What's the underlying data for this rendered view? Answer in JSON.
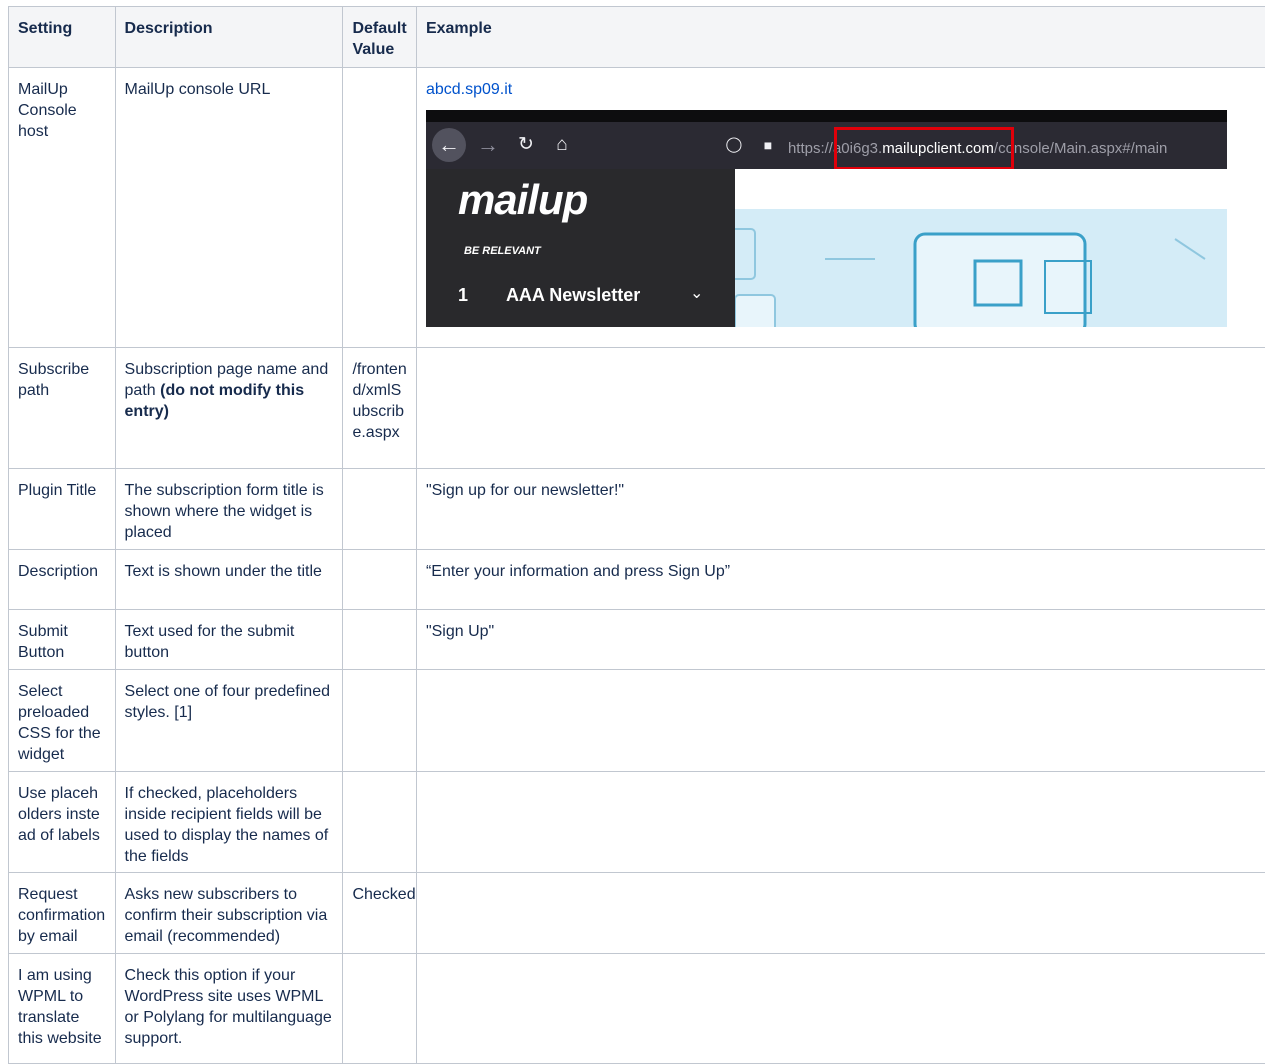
{
  "headers": {
    "setting": "Setting",
    "description": "Description",
    "default": "Default Value",
    "example": "Example"
  },
  "rows": [
    {
      "setting": "MailUp Console host",
      "description": "MailUp console URL",
      "default": "",
      "example": "abcd.sp09.it"
    },
    {
      "setting": "Subscribe path",
      "description": "Subscription page name and path ",
      "description_bold": "(do not modify this entry)",
      "default": "/frontend/xmlSubscribe.aspx",
      "example": ""
    },
    {
      "setting": "Plugin Title",
      "description": "The subscription form title is shown where the widget is placed",
      "default": "",
      "example": "\"Sign up for our newsletter!\""
    },
    {
      "setting": "Description",
      "description": "Text is shown under the title",
      "default": "",
      "example": "“Enter your information and press Sign Up”"
    },
    {
      "setting": "Submit Button",
      "description": "Text used for the submit button",
      "default": "",
      "example": "\"Sign Up\""
    },
    {
      "setting": "Select preloaded CSS for the widget",
      "description": "Select one of four predefined styles. [1]",
      "default": "",
      "example": ""
    },
    {
      "setting": "Use placeholders instead of labels",
      "description": "If checked, placeholders inside recipient fields will be used to display the names of the fields",
      "default": "",
      "example": ""
    },
    {
      "setting": "Request confirmation by email",
      "description": "Asks new subscribers to confirm their subscription via email (recommended)",
      "default": "Checked",
      "example": ""
    },
    {
      "setting": "I am using WPML to translate this website",
      "description": "Check this option if your WordPress site uses WPML or Polylang for multilanguage support.",
      "default": "",
      "example": ""
    }
  ],
  "screenshot": {
    "url_prefix": "https://",
    "url_host_pre": "a0i6g3.",
    "url_host": "mailupclient.com",
    "url_path": "/console/Main.aspx#/main",
    "logo": "mailup",
    "tagline": "BE RELEVANT",
    "list_number": "1",
    "list_name": "AAA Newsletter",
    "icons": [
      "back-arrow-icon",
      "forward-arrow-icon",
      "reload-icon",
      "home-icon",
      "shield-icon",
      "lock-icon",
      "chevron-down-icon"
    ],
    "colors": {
      "highlight": "#e0000a",
      "link": "#0052cc",
      "header_bg": "#f4f5f7"
    }
  }
}
